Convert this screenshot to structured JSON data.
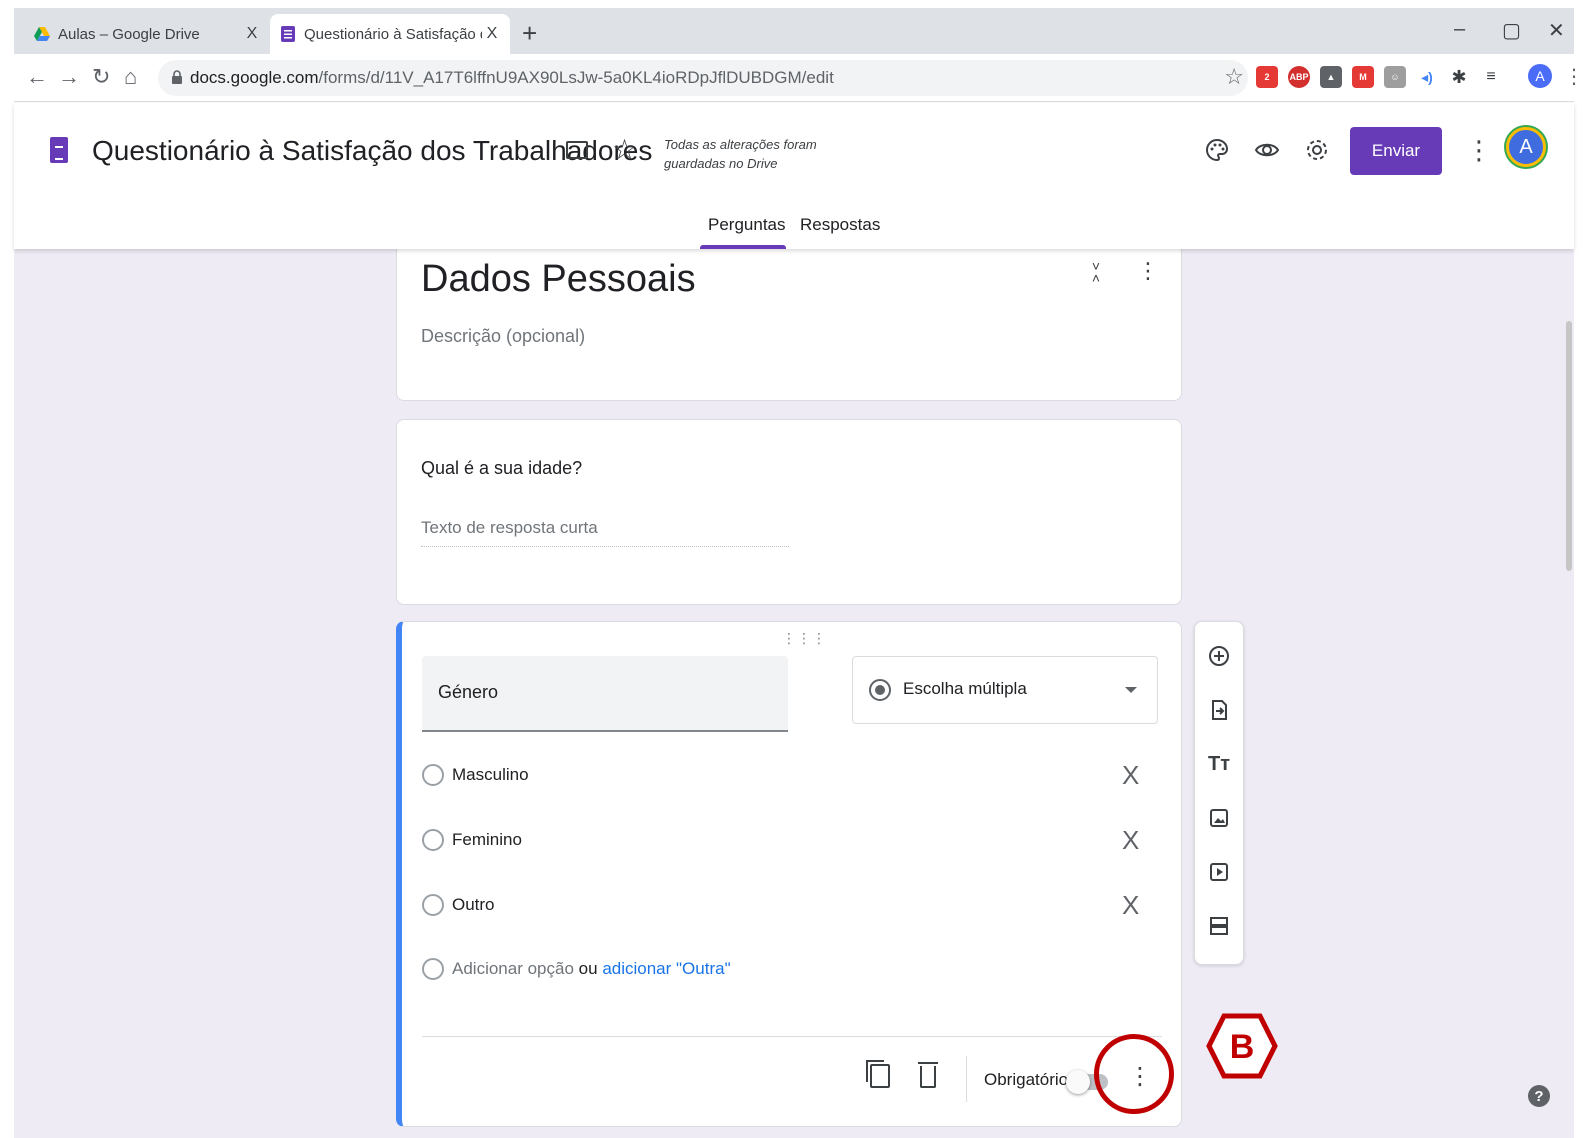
{
  "browser": {
    "tabs": [
      {
        "title": "Aulas – Google Drive"
      },
      {
        "title": "Questionário à Satisfação dos Tra"
      }
    ],
    "tab_close": "X",
    "new_tab": "+",
    "url_host": "docs.google.com",
    "url_path": "/forms/d/11V_A17T6lffnU9AX90LsJw-5a0KL4ioRDpJflDUBDGM/edit",
    "profile_initial": "A"
  },
  "header": {
    "form_title": "Questionário à Satisfação dos Trabalhadores",
    "save_status": "Todas as alterações foram guardadas no Drive",
    "send_label": "Enviar",
    "avatar_initial": "A",
    "tabs": [
      {
        "label": "Perguntas",
        "active": true
      },
      {
        "label": "Respostas",
        "active": false
      }
    ]
  },
  "section": {
    "title": "Dados Pessoais",
    "description_placeholder": "Descrição (opcional)"
  },
  "question1": {
    "title": "Qual é a sua idade?",
    "answer_placeholder": "Texto de resposta curta"
  },
  "question2": {
    "title": "Género",
    "type_label": "Escolha múltipla",
    "options": [
      {
        "label": "Masculino"
      },
      {
        "label": "Feminino"
      },
      {
        "label": "Outro"
      }
    ],
    "remove_symbol": "X",
    "add_option_label": "Adicionar opção",
    "add_or": "ou",
    "add_other_label": "adicionar \"Outra\"",
    "required_label": "Obrigatório",
    "required": false
  },
  "annotation": {
    "badge_letter": "B",
    "color": "#c00000"
  },
  "colors": {
    "accent": "#673ab7",
    "active_question_border": "#4285f4",
    "canvas_bg": "#efebf5"
  },
  "help_symbol": "?"
}
